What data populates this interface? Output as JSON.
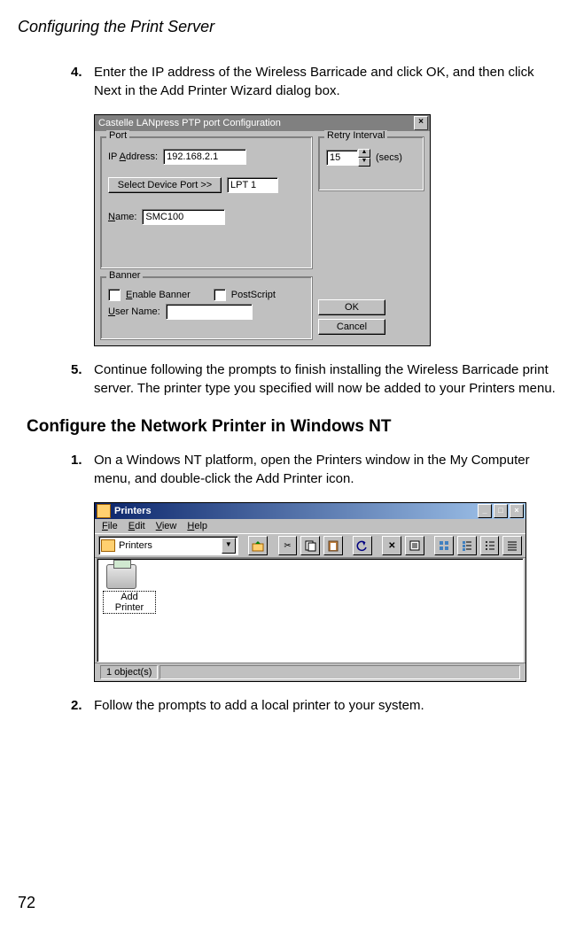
{
  "header": {
    "title": "Configuring the Print Server"
  },
  "steps": {
    "s4": {
      "num": "4.",
      "text": "Enter the IP address of the Wireless Barricade and click OK, and then click Next in the Add Printer Wizard dialog box."
    },
    "s5": {
      "num": "5.",
      "text": "Continue following the prompts to finish installing the Wireless Barricade print server. The printer type you specified will now be added to your Printers menu."
    },
    "s1": {
      "num": "1.",
      "text": "On a Windows NT platform, open the Printers window in the My Computer menu, and double-click the Add Printer icon."
    },
    "s2": {
      "num": "2.",
      "text": "Follow the prompts to add a local printer to your system."
    }
  },
  "section": {
    "heading": "Configure the Network Printer in Windows NT"
  },
  "dialog1": {
    "title": "Castelle LANpress PTP port   Configuration",
    "groups": {
      "port": "Port",
      "retry": "Retry Interval",
      "banner": "Banner"
    },
    "labels": {
      "ip": "IP Address:",
      "select_port": "Select Device Port >>",
      "lpt": "LPT 1",
      "name": "Name:",
      "secs": "(secs)",
      "enable_banner": "Enable Banner",
      "postscript": "PostScript",
      "user_name": "User Name:"
    },
    "values": {
      "ip": "192.168.2.1",
      "name": "SMC100",
      "retry": "15"
    },
    "buttons": {
      "ok": "OK",
      "cancel": "Cancel"
    }
  },
  "window2": {
    "title": "Printers",
    "menu": {
      "file": "File",
      "edit": "Edit",
      "view": "View",
      "help": "Help"
    },
    "addr": "Printers",
    "icon_label": "Add Printer",
    "status": "1 object(s)"
  },
  "page_number": "72"
}
